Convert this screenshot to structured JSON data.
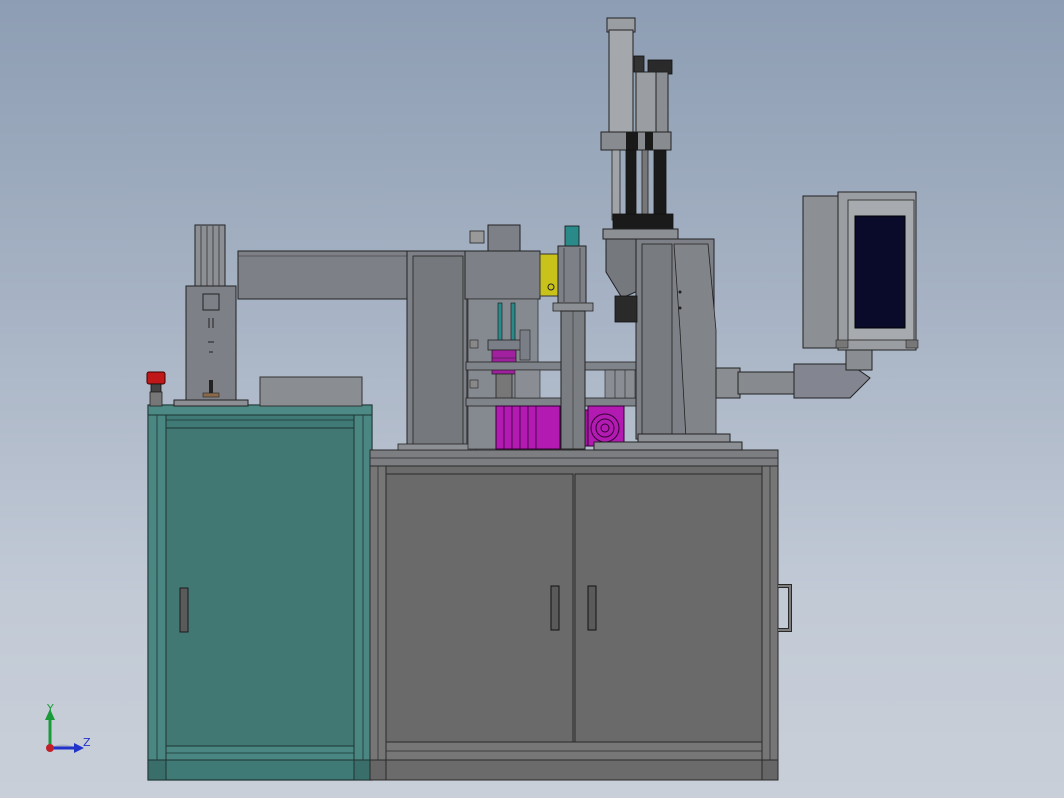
{
  "triad": {
    "y_label": "Y",
    "z_label": "Z",
    "x_color": "#c0202a",
    "y_color": "#1a9a3a",
    "z_color": "#2233cc"
  },
  "colors": {
    "background_top": "#8d9db3",
    "background_bottom": "#c9cfd8",
    "teal_cabinet": "#417874",
    "grey_cabinet": "#6b6b6b",
    "frame_grey": "#7a7c80",
    "motor_magenta": "#b21ab2",
    "accent_yellow": "#c9c21a",
    "emergency_red": "#c01818",
    "screen_dark": "#0a0a2a"
  },
  "components": [
    "teal-electrical-cabinet",
    "grey-base-cabinet",
    "left-control-column",
    "emergency-stop-button",
    "horizontal-beam",
    "center-frame-column",
    "magenta-motor",
    "vertical-spindle",
    "press-cylinder-assembly",
    "press-column",
    "hmi-display-box",
    "hmi-support-arm",
    "side-handle"
  ]
}
